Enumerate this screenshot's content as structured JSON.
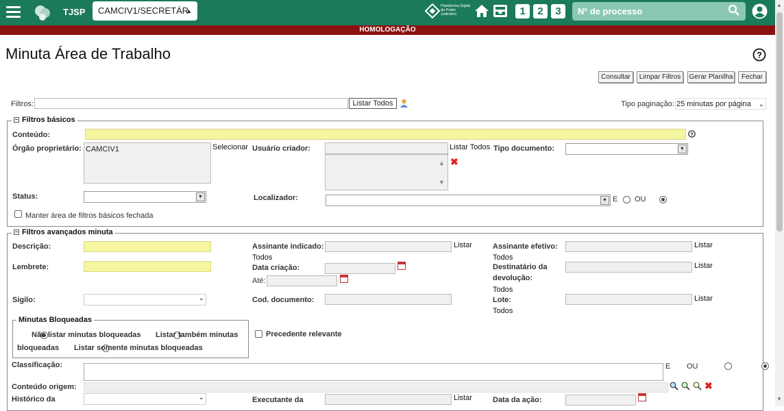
{
  "header": {
    "tribunal": "TJSP",
    "unit_select": "CAMCIV1/SECRETÁR",
    "platform_logo_text": "Plataforma Digital do Poder Judiciário",
    "nav_numbers": [
      "1",
      "2",
      "3"
    ],
    "search_placeholder": "Nº de processo"
  },
  "banner": "HOMOLOGAÇÃO",
  "page": {
    "title": "Minuta Área de Trabalho",
    "buttons": {
      "consultar": "Consultar",
      "limpar": "Limpar Filtros",
      "gerar": "Gerar Planilha",
      "fechar": "Fechar"
    }
  },
  "filtros": {
    "label": "Filtros:",
    "listar_todos": "Listar Todos",
    "tipo_paginacao_label": "Tipo paginação:",
    "tipo_paginacao_value": "25 minutas por página"
  },
  "basicos": {
    "legend": "Filtros básicos",
    "conteudo": "Conteúdo:",
    "orgao": "Órgão proprietário:",
    "orgao_value": "CAMCIV1",
    "selecionar": "Selecionar",
    "usuario_criador": "Usuário criador:",
    "listar_todos": "Listar Todos",
    "tipo_documento": "Tipo documento:",
    "status": "Status:",
    "localizador": "Localizador:",
    "e": "E",
    "ou": "OU",
    "manter": "Manter área de filtros básicos fechada"
  },
  "avancados": {
    "legend": "Filtros avançados minuta",
    "descricao": "Descrição:",
    "assinante_indicado": "Assinante indicado:",
    "listar": "Listar",
    "todos": "Todos",
    "assinante_efetivo": "Assinante efetivo:",
    "lembrete": "Lembrete:",
    "data_criacao": "Data criação:",
    "ate": "Até:",
    "destinatario_1": "Destinatário da",
    "destinatario_2": "devolução:",
    "sigilo": "Sigilo:",
    "cod_documento": "Cod. documento:",
    "lote": "Lote:",
    "bloqueadas_legend": "Minutas Bloqueadas",
    "nao_listar": "Não listar minutas bloqueadas",
    "listar_tambem_1": "Listar também minutas",
    "listar_tambem_2": "bloqueadas",
    "listar_somente": "Listar somente minutas bloqueadas",
    "precedente": "Precedente relevante",
    "classificacao": "Classificação:",
    "e": "E",
    "ou": "OU",
    "conteudo_origem": "Conteúdo origem:",
    "historico": "Histórico da",
    "executante": "Executante da",
    "data_acao": "Data da ação:"
  }
}
